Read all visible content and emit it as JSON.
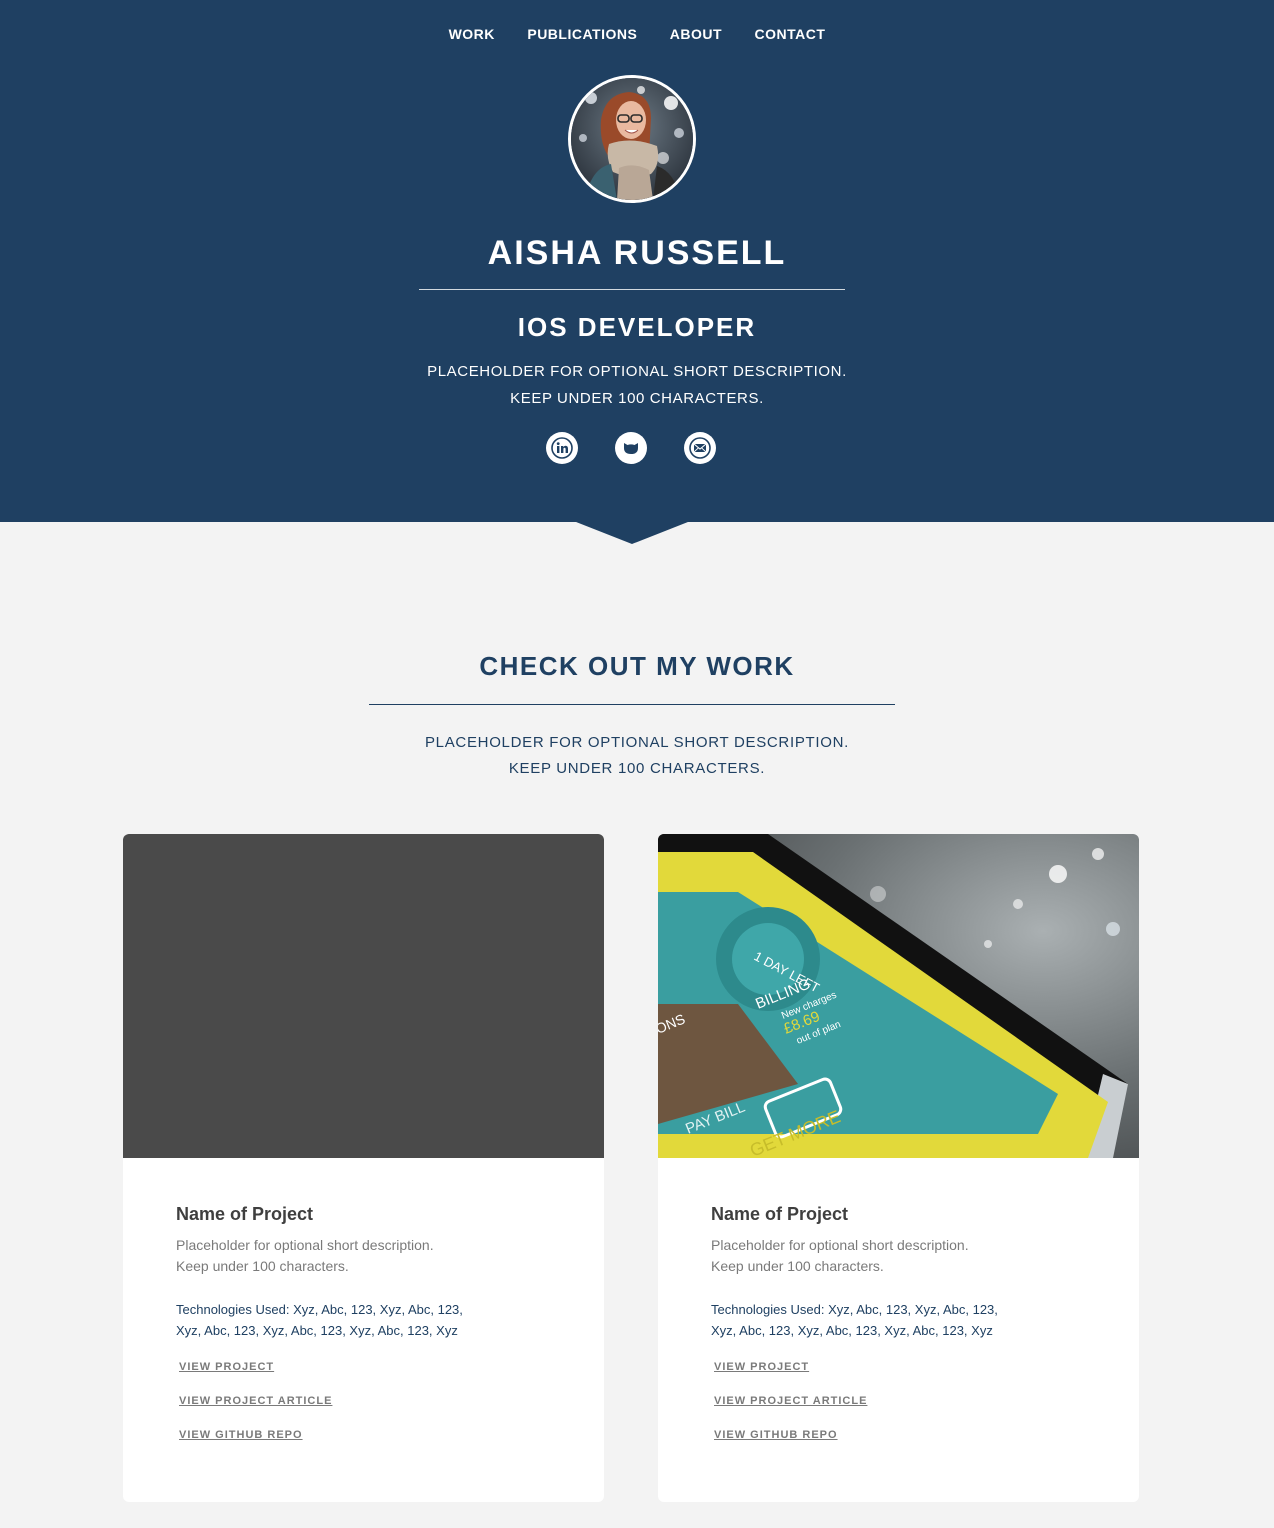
{
  "nav": {
    "items": [
      "WORK",
      "PUBLICATIONS",
      "ABOUT",
      "CONTACT"
    ]
  },
  "hero": {
    "name": "AISHA RUSSELL",
    "role": "IOS DEVELOPER",
    "desc_line1": "PLACEHOLDER FOR OPTIONAL SHORT DESCRIPTION.",
    "desc_line2": "KEEP UNDER 100 CHARACTERS.",
    "social_icons": [
      "linkedin-icon",
      "github-icon",
      "email-icon"
    ],
    "background_color": "#1f4062"
  },
  "work": {
    "title": "CHECK OUT MY WORK",
    "desc_line1": "PLACEHOLDER FOR OPTIONAL SHORT DESCRIPTION.",
    "desc_line2": "KEEP UNDER 100 CHARACTERS."
  },
  "projects": [
    {
      "name": "Name of Project",
      "desc_line1": "Placeholder for optional short description.",
      "desc_line2": "Keep under 100 characters.",
      "tech_line1": "Technologies Used: Xyz, Abc, 123, Xyz, Abc, 123,",
      "tech_line2": "Xyz, Abc, 123, Xyz, Abc, 123, Xyz, Abc, 123, Xyz",
      "link_project": "VIEW PROJECT",
      "link_article": "VIEW PROJECT ARTICLE",
      "link_repo": "VIEW GITHUB REPO"
    },
    {
      "name": "Name of Project",
      "desc_line1": "Placeholder for optional short description.",
      "desc_line2": "Keep under 100 characters.",
      "tech_line1": "Technologies Used: Xyz, Abc, 123, Xyz, Abc, 123,",
      "tech_line2": "Xyz, Abc, 123, Xyz, Abc, 123, Xyz, Abc, 123, Xyz",
      "link_project": "VIEW PROJECT",
      "link_article": "VIEW PROJECT ARTICLE",
      "link_repo": "VIEW GITHUB REPO",
      "phone_screen": {
        "tile_1": "1 DAY LEFT",
        "billing_title": "BILLING",
        "billing_sub": "New charges",
        "billing_amount": "£8.69",
        "billing_note": "out of plan",
        "pay_bill": "PAY BILL",
        "get_more": "GET MORE",
        "ons": "ONS"
      }
    }
  ]
}
